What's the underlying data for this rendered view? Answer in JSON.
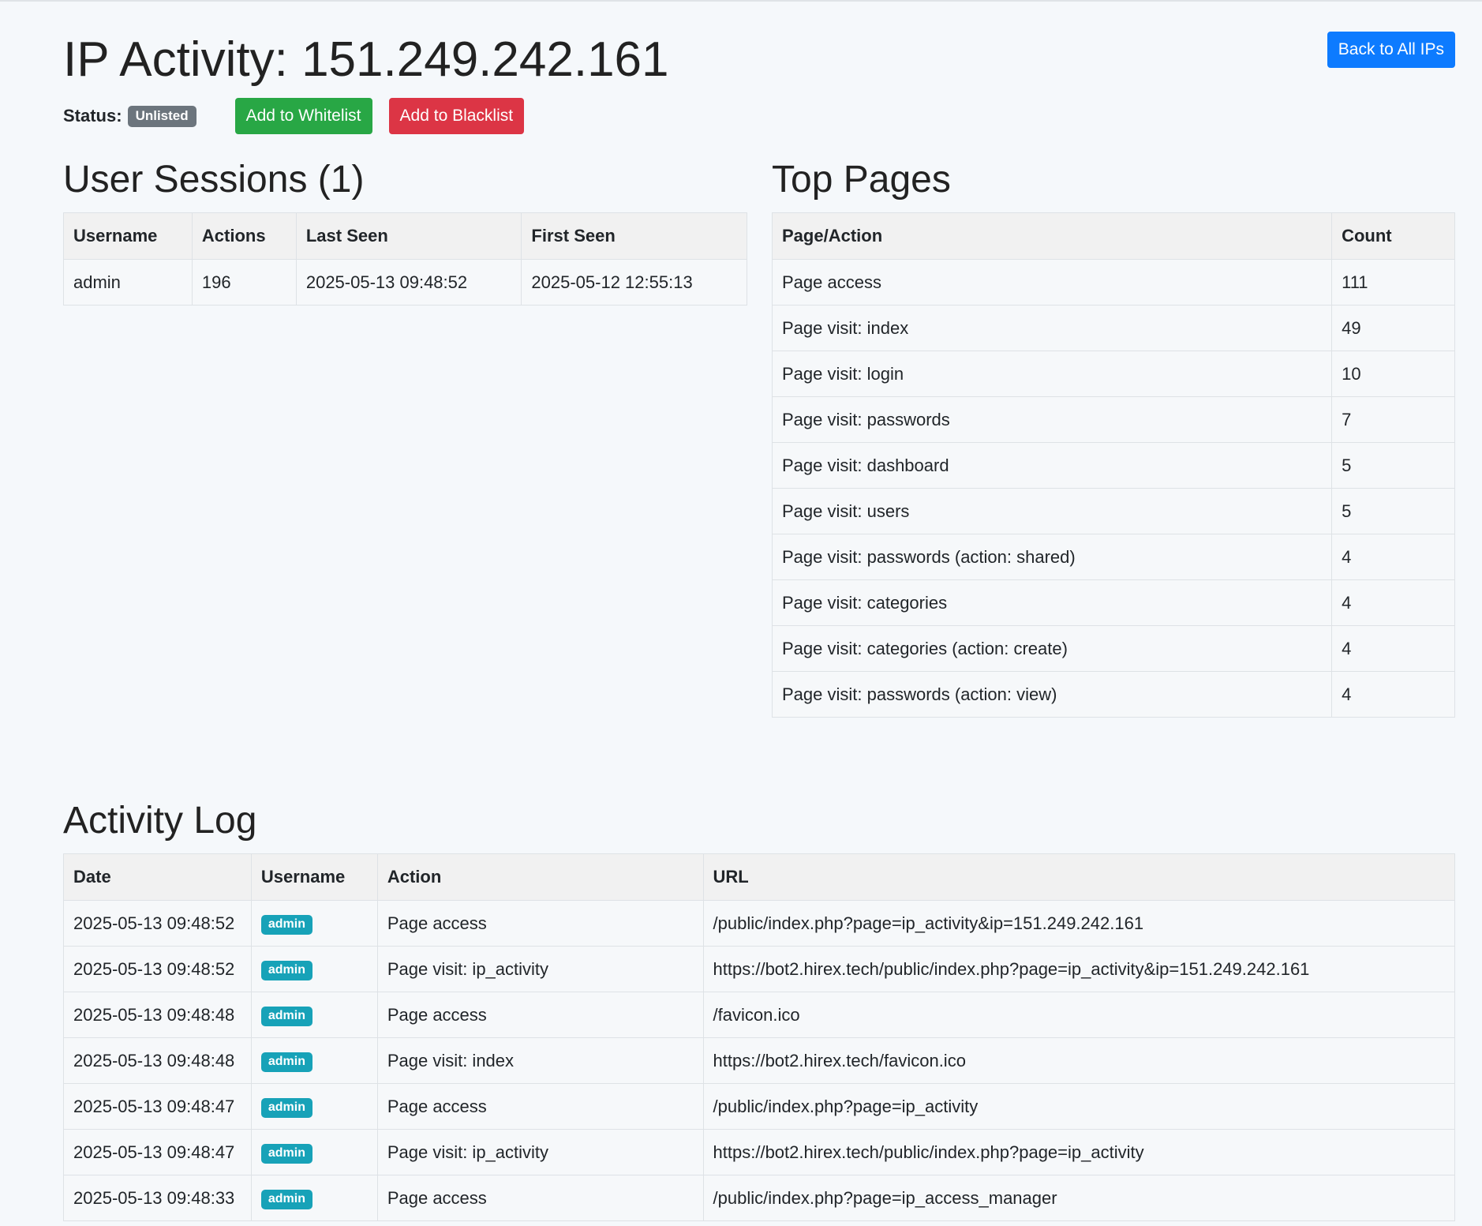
{
  "header": {
    "title": "IP Activity: 151.249.242.161",
    "back_label": "Back to All IPs"
  },
  "status": {
    "label": "Status:",
    "value": "Unlisted",
    "whitelist_label": "Add to Whitelist",
    "blacklist_label": "Add to Blacklist"
  },
  "sessions": {
    "title": "User Sessions (1)",
    "headers": [
      "Username",
      "Actions",
      "Last Seen",
      "First Seen"
    ],
    "rows": [
      [
        "admin",
        "196",
        "2025-05-13 09:48:52",
        "2025-05-12 12:55:13"
      ]
    ]
  },
  "top_pages": {
    "title": "Top Pages",
    "headers": [
      "Page/Action",
      "Count"
    ],
    "rows": [
      [
        "Page access",
        "111"
      ],
      [
        "Page visit: index",
        "49"
      ],
      [
        "Page visit: login",
        "10"
      ],
      [
        "Page visit: passwords",
        "7"
      ],
      [
        "Page visit: dashboard",
        "5"
      ],
      [
        "Page visit: users",
        "5"
      ],
      [
        "Page visit: passwords (action: shared)",
        "4"
      ],
      [
        "Page visit: categories",
        "4"
      ],
      [
        "Page visit: categories (action: create)",
        "4"
      ],
      [
        "Page visit: passwords (action: view)",
        "4"
      ]
    ]
  },
  "activity_log": {
    "title": "Activity Log",
    "headers": [
      "Date",
      "Username",
      "Action",
      "URL"
    ],
    "rows": [
      [
        "2025-05-13 09:48:52",
        "admin",
        "Page access",
        "/public/index.php?page=ip_activity&ip=151.249.242.161"
      ],
      [
        "2025-05-13 09:48:52",
        "admin",
        "Page visit: ip_activity",
        "https://bot2.hirex.tech/public/index.php?page=ip_activity&ip=151.249.242.161"
      ],
      [
        "2025-05-13 09:48:48",
        "admin",
        "Page access",
        "/favicon.ico"
      ],
      [
        "2025-05-13 09:48:48",
        "admin",
        "Page visit: index",
        "https://bot2.hirex.tech/favicon.ico"
      ],
      [
        "2025-05-13 09:48:47",
        "admin",
        "Page access",
        "/public/index.php?page=ip_activity"
      ],
      [
        "2025-05-13 09:48:47",
        "admin",
        "Page visit: ip_activity",
        "https://bot2.hirex.tech/public/index.php?page=ip_activity"
      ],
      [
        "2025-05-13 09:48:33",
        "admin",
        "Page access",
        "/public/index.php?page=ip_access_manager"
      ]
    ]
  }
}
